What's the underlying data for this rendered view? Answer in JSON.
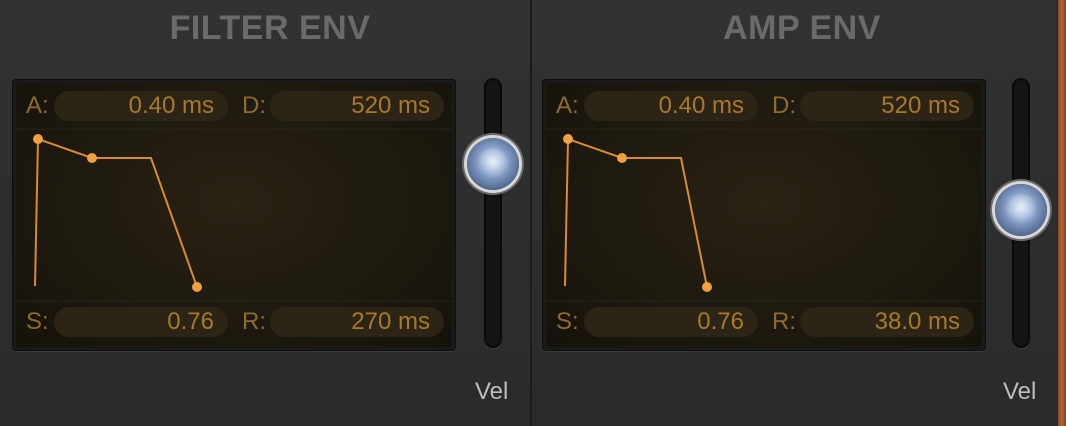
{
  "filter_env": {
    "title": "FILTER ENV",
    "attack_label": "A:",
    "attack_value": "0.40 ms",
    "decay_label": "D:",
    "decay_value": "520 ms",
    "sustain_label": "S:",
    "sustain_value": "0.76",
    "release_label": "R:",
    "release_value": "270 ms",
    "vel_label": "Vel",
    "vel_level": 0.7
  },
  "amp_env": {
    "title": "AMP ENV",
    "attack_label": "A:",
    "attack_value": "0.40 ms",
    "decay_label": "D:",
    "decay_value": "520 ms",
    "sustain_label": "S:",
    "sustain_value": "0.76",
    "release_label": "R:",
    "release_value": "38.0 ms",
    "vel_label": "Vel",
    "vel_level": 0.5
  },
  "colors": {
    "envelope_line": "#d98a35",
    "envelope_point": "#f0a040",
    "value_text": "#a9782f",
    "label_text": "#8f6a2e"
  }
}
